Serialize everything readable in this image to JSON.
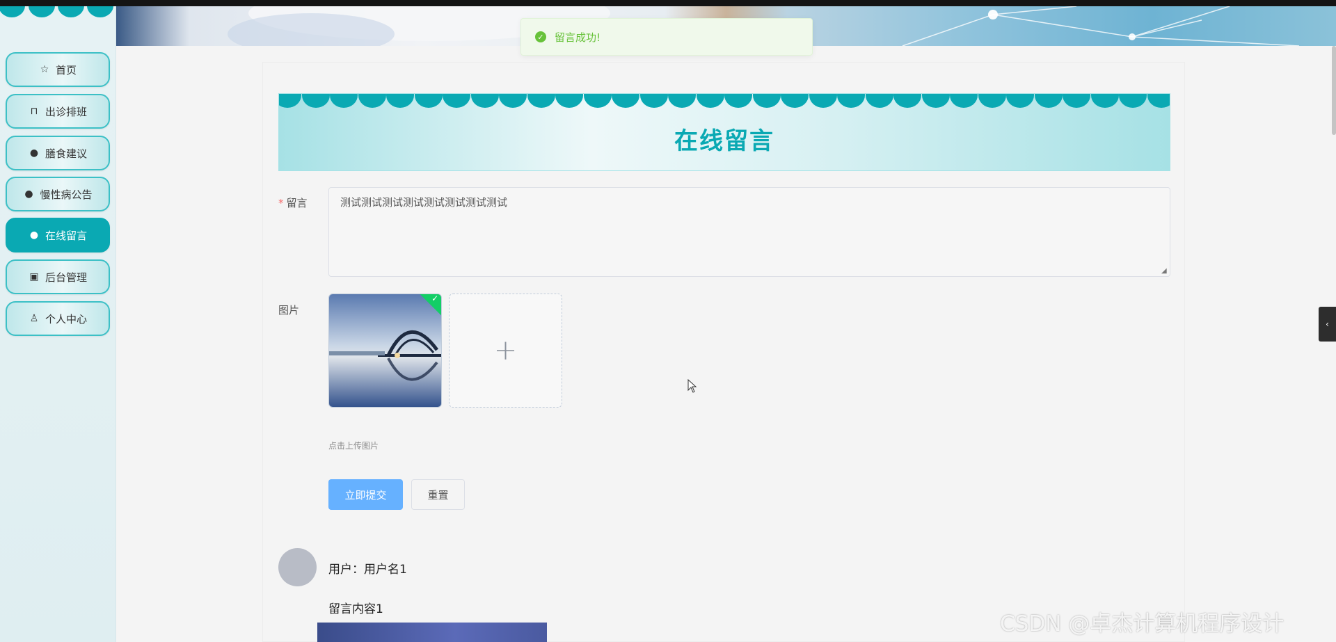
{
  "toast": {
    "message": "留言成功!"
  },
  "sidebar": {
    "items": [
      {
        "label": "首页",
        "icon": "star-icon"
      },
      {
        "label": "出诊排班",
        "icon": "bag-icon"
      },
      {
        "label": "膳食建议",
        "icon": "exclamation-icon"
      },
      {
        "label": "慢性病公告",
        "icon": "question-icon"
      },
      {
        "label": "在线留言",
        "icon": "info-icon",
        "active": true
      },
      {
        "label": "后台管理",
        "icon": "box-icon"
      },
      {
        "label": "个人中心",
        "icon": "user-icon"
      }
    ]
  },
  "page": {
    "title": "在线留言"
  },
  "form": {
    "message_label": "留言",
    "message_value": "测试测试测试测试测试测试测试测试",
    "image_label": "图片",
    "upload_tip": "点击上传图片",
    "submit_label": "立即提交",
    "reset_label": "重置"
  },
  "comments": [
    {
      "user": "用户：用户名1",
      "content": "留言内容1"
    }
  ],
  "watermark": "CSDN @卓杰计算机程序设计",
  "colors": {
    "accent": "#0aa9b3",
    "primary": "#66b1ff",
    "success": "#67c23a"
  }
}
